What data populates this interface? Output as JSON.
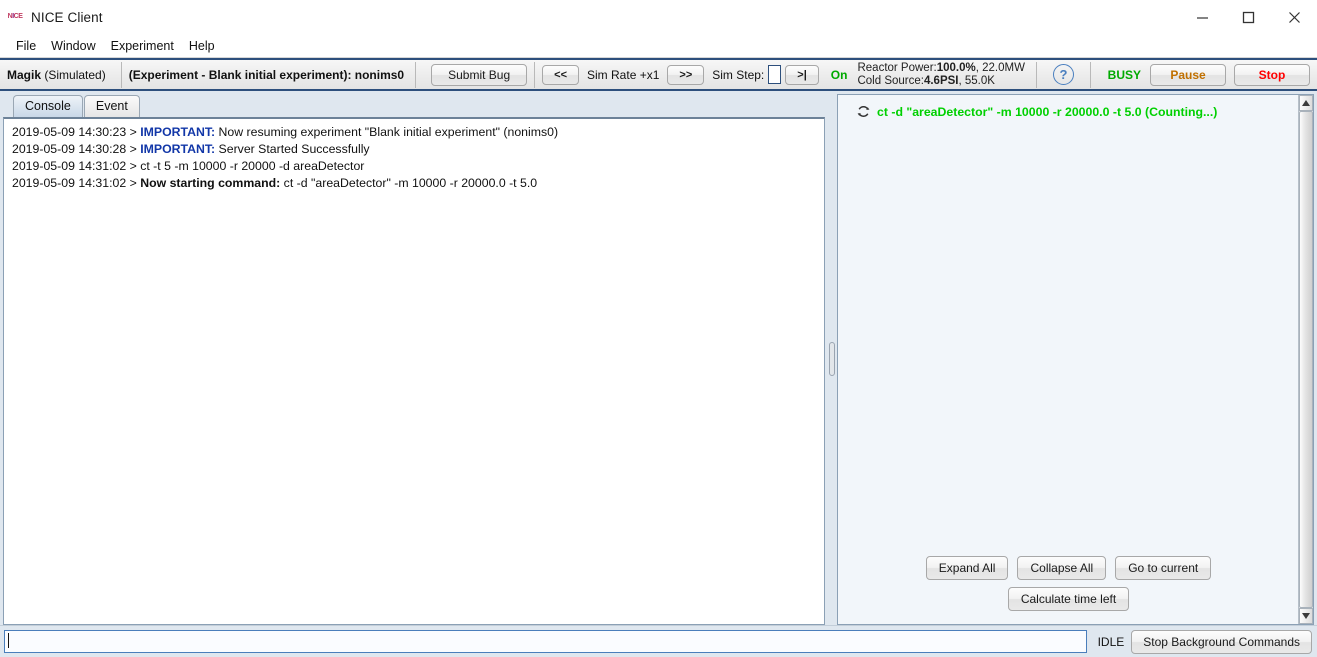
{
  "window": {
    "title": "NICE Client",
    "logo_text": "NICE",
    "minimize_label": "minimize",
    "maximize_label": "maximize",
    "close_label": "close"
  },
  "menubar": {
    "items": [
      {
        "label": "File"
      },
      {
        "label": "Window"
      },
      {
        "label": "Experiment"
      },
      {
        "label": "Help"
      }
    ]
  },
  "toolbar": {
    "instrument_name": "Magik",
    "instrument_mode": "(Simulated)",
    "experiment_label": "(Experiment - Blank initial experiment): nonims0",
    "submit_bug_label": "Submit Bug",
    "sim_rate_prev_label": "<<",
    "sim_rate_label": "Sim Rate +x1",
    "sim_rate_next_label": ">>",
    "sim_step_label": "Sim Step:",
    "sim_step_value": "",
    "sim_step_next_label": ">|",
    "on_status": "On",
    "reactor_power_label": "Reactor Power:",
    "reactor_power_value": "100.0%",
    "reactor_power_extra": ", 22.0MW",
    "cold_source_label": "Cold Source:",
    "cold_source_value": "4.6PSI",
    "cold_source_extra": ", 55.0K",
    "help_glyph": "?",
    "busy_status": "BUSY",
    "pause_label": "Pause",
    "stop_label": "Stop"
  },
  "left_panel": {
    "tabs": [
      {
        "label": "Console",
        "active": true
      },
      {
        "label": "Event",
        "active": false
      }
    ],
    "log_entries": [
      {
        "timestamp": "2019-05-09 14:30:23 > ",
        "tag": "IMPORTANT:",
        "tag_style": "important",
        "message": " Now resuming experiment \"Blank initial experiment\" (nonims0)"
      },
      {
        "timestamp": "2019-05-09 14:30:28 > ",
        "tag": "IMPORTANT:",
        "tag_style": "important",
        "message": " Server Started Successfully"
      },
      {
        "timestamp": "2019-05-09 14:31:02 > ",
        "tag": "",
        "tag_style": "plain",
        "message": "ct -t 5 -m 10000 -r 20000 -d areaDetector"
      },
      {
        "timestamp": "2019-05-09 14:31:02 > ",
        "tag": "Now starting command:",
        "tag_style": "bold",
        "message": " ct -d \"areaDetector\" -m 10000 -r 20000.0 -t 5.0"
      }
    ]
  },
  "right_panel": {
    "commands": [
      {
        "icon": "refresh-spinner-icon",
        "text": "ct -d \"areaDetector\" -m 10000 -r 20000.0 -t 5.0 (Counting...)",
        "color": "#00d000"
      }
    ],
    "buttons": {
      "expand_all": "Expand All",
      "collapse_all": "Collapse All",
      "go_to_current": "Go to current",
      "calculate_time_left": "Calculate time left"
    },
    "scrollbar": {
      "up_arrow": "scroll-up",
      "down_arrow": "scroll-down"
    }
  },
  "bottom_bar": {
    "command_input_value": "",
    "command_input_placeholder": "",
    "status_label": "IDLE",
    "stop_background_label": "Stop Background Commands"
  },
  "colors": {
    "accent_border": "#2d4f7c",
    "on_green": "#00aa00",
    "busy_green": "#00aa00",
    "pause_orange": "#c07000",
    "stop_red": "#ff0000",
    "command_green": "#00d000",
    "important_blue": "#1237a8",
    "panel_background": "#dfe7ef"
  }
}
